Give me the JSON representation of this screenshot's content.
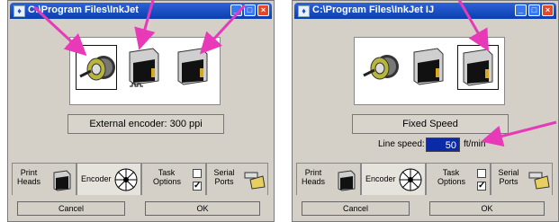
{
  "left": {
    "title": "C:\\Program Files\\InkJet",
    "status": "External encoder: 300 ppi",
    "tabs": {
      "print_heads": "Print\nHeads",
      "encoder": "Encoder",
      "task_options": "Task\nOptions",
      "serial_ports": "Serial\nPorts"
    },
    "buttons": {
      "cancel": "Cancel",
      "ok": "OK"
    },
    "selected_icon": "encoder-icon"
  },
  "right": {
    "title": "C:\\Program Files\\InkJet   IJ",
    "status": "Fixed Speed",
    "line_speed": {
      "label": "Line speed:",
      "value": "50",
      "unit": "ft/min"
    },
    "tabs": {
      "print_heads": "Print\nHeads",
      "encoder": "Encoder",
      "task_options": "Task\nOptions",
      "serial_ports": "Serial\nPorts"
    },
    "buttons": {
      "cancel": "Cancel",
      "ok": "OK"
    },
    "selected_icon": "fixed-speed-icon"
  },
  "colors": {
    "title_bar": "#0a3fb0",
    "annotation_arrow": "#e83ab8",
    "speed_field": "#0a2aa8"
  },
  "icons": [
    "encoder-icon",
    "print-head-icon",
    "fixed-speed-icon",
    "serial-port-icon",
    "checkbox-icon"
  ]
}
